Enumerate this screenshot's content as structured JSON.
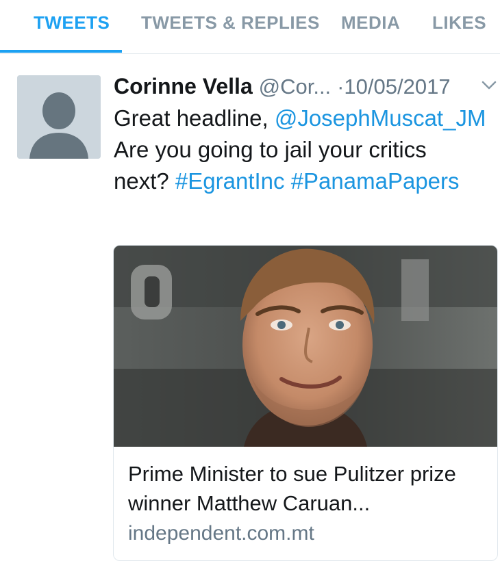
{
  "tabs": [
    {
      "label": "TWEETS",
      "active": true
    },
    {
      "label": "TWEETS & REPLIES",
      "active": false
    },
    {
      "label": "MEDIA",
      "active": false
    },
    {
      "label": "LIKES",
      "active": false
    }
  ],
  "colors": {
    "accent": "#1da1f2",
    "link": "#1b95e0",
    "muted": "#657786",
    "tab_inactive": "#8899a6"
  },
  "tweet": {
    "display_name": "Corinne Vella",
    "handle": "@Cor...",
    "separator": "·",
    "date": "10/05/2017",
    "text": {
      "part1": "Great headline, ",
      "mention": "@JosephMuscat_JM",
      "part2": " Are you going to jail your critics next? ",
      "hashtag1": "#EgrantInc",
      "space": " ",
      "hashtag2": "#PanamaPapers"
    },
    "avatar_icon": "default-profile-icon",
    "menu_icon": "chevron-down-icon"
  },
  "card": {
    "image_icon": "article-photo",
    "title": "Prime Minister to sue Pulitzer prize winner Matthew Caruan...",
    "domain": "independent.com.mt"
  }
}
